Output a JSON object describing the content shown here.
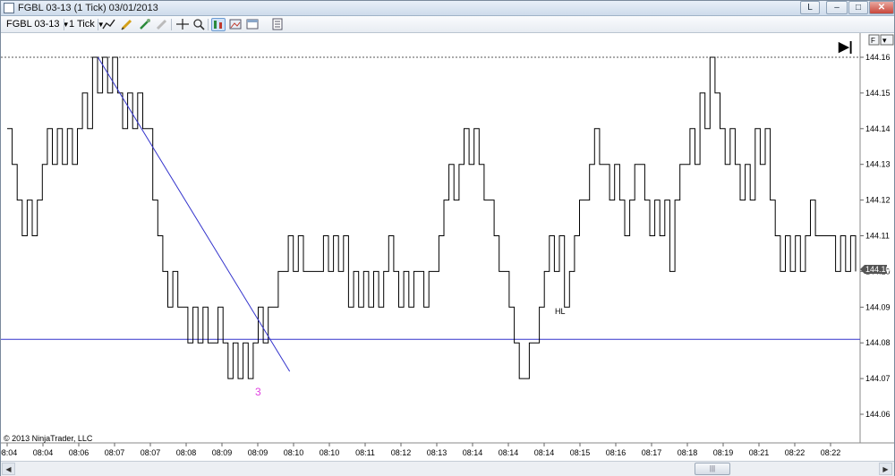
{
  "window": {
    "title": "FGBL 03-13 (1 Tick)  03/01/2013",
    "buttons": {
      "l": "L",
      "minimize": "–",
      "maximize": "□",
      "close": "✕"
    }
  },
  "toolbar": {
    "instrument": "FGBL 03-13",
    "interval": "1 Tick",
    "icons": [
      "draw-line-icon",
      "pencil-icon",
      "paint-icon",
      "eraser-icon",
      "crosshair-icon",
      "zoom-icon",
      "bars-icon",
      "image-icon",
      "window-icon",
      "properties-icon"
    ]
  },
  "chart": {
    "copyright": "© 2013 NinjaTrader, LLC",
    "annotation_hl": "HL",
    "annotation_count": "3",
    "last_price_badge": "144.10",
    "panel_buttons": {
      "f": "F",
      "menu": "▾",
      "go_end": "▶|"
    },
    "colors": {
      "price": "#000000",
      "trendline": "#3333cc",
      "hline": "#3333cc",
      "count": "#e040e0",
      "top_dotted": "#555555"
    }
  },
  "chart_data": {
    "type": "line",
    "title": "",
    "xlabel": "",
    "ylabel": "",
    "ylim": [
      144.055,
      144.165
    ],
    "y_ticks": [
      "144.16",
      "144.15",
      "144.14",
      "144.13",
      "144.12",
      "144.11",
      "144.10",
      "144.09",
      "144.08",
      "144.07",
      "144.06"
    ],
    "x_ticks": [
      "08:04",
      "08:04",
      "08:06",
      "08:07",
      "08:07",
      "08:08",
      "08:09",
      "08:09",
      "08:10",
      "08:10",
      "08:11",
      "08:12",
      "08:13",
      "08:14",
      "08:14",
      "08:14",
      "08:15",
      "08:16",
      "08:17",
      "08:18",
      "08:19",
      "08:21",
      "08:22",
      "08:22"
    ],
    "series": [
      {
        "values": [
          144.14,
          144.13,
          144.12,
          144.11,
          144.12,
          144.11,
          144.12,
          144.13,
          144.14,
          144.13,
          144.14,
          144.13,
          144.14,
          144.13,
          144.14,
          144.15,
          144.14,
          144.16,
          144.15,
          144.16,
          144.15,
          144.16,
          144.15,
          144.14,
          144.15,
          144.14,
          144.15,
          144.14,
          144.14,
          144.12,
          144.11,
          144.1,
          144.09,
          144.1,
          144.09,
          144.09,
          144.08,
          144.09,
          144.08,
          144.09,
          144.08,
          144.08,
          144.09,
          144.08,
          144.07,
          144.08,
          144.07,
          144.08,
          144.07,
          144.08,
          144.09,
          144.08,
          144.09,
          144.09,
          144.1,
          144.1,
          144.11,
          144.1,
          144.11,
          144.1,
          144.1,
          144.1,
          144.1,
          144.11,
          144.1,
          144.11,
          144.1,
          144.11,
          144.09,
          144.1,
          144.09,
          144.1,
          144.09,
          144.1,
          144.09,
          144.1,
          144.11,
          144.1,
          144.09,
          144.1,
          144.09,
          144.1,
          144.1,
          144.09,
          144.1,
          144.1,
          144.11,
          144.12,
          144.13,
          144.12,
          144.13,
          144.14,
          144.13,
          144.14,
          144.13,
          144.12,
          144.12,
          144.11,
          144.1,
          144.1,
          144.09,
          144.08,
          144.07,
          144.07,
          144.08,
          144.08,
          144.09,
          144.1,
          144.11,
          144.1,
          144.11,
          144.09,
          144.1,
          144.11,
          144.12,
          144.12,
          144.13,
          144.14,
          144.13,
          144.13,
          144.12,
          144.13,
          144.12,
          144.11,
          144.12,
          144.13,
          144.13,
          144.12,
          144.11,
          144.12,
          144.11,
          144.12,
          144.1,
          144.12,
          144.13,
          144.13,
          144.14,
          144.13,
          144.15,
          144.14,
          144.16,
          144.15,
          144.14,
          144.13,
          144.14,
          144.13,
          144.12,
          144.13,
          144.12,
          144.14,
          144.13,
          144.14,
          144.12,
          144.11,
          144.1,
          144.11,
          144.1,
          144.11,
          144.1,
          144.11,
          144.12,
          144.11,
          144.11,
          144.11,
          144.11,
          144.1,
          144.11,
          144.1,
          144.11,
          144.1
        ]
      }
    ],
    "trendline": {
      "from": {
        "x_frac": 0.107,
        "y": 144.16
      },
      "to": {
        "x_frac": 0.333,
        "y": 144.072
      }
    },
    "horizontal_line": 144.081,
    "dotted_top_line": 144.16,
    "last_price": 144.1
  }
}
